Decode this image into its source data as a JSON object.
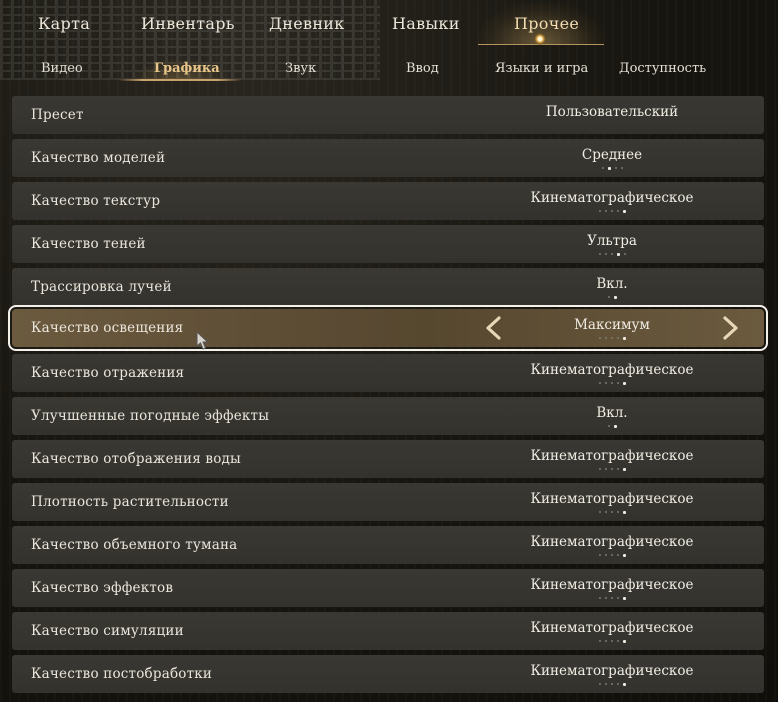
{
  "topnav": {
    "tabs": [
      {
        "label": "Карта"
      },
      {
        "label": "Инвентарь"
      },
      {
        "label": "Дневник"
      },
      {
        "label": "Навыки"
      },
      {
        "label": "Прочее"
      }
    ],
    "active": "Прочее"
  },
  "subnav": {
    "tabs": [
      {
        "label": "Видео"
      },
      {
        "label": "Графика"
      },
      {
        "label": "Звук"
      },
      {
        "label": "Ввод"
      },
      {
        "label": "Языки и игра"
      },
      {
        "label": "Доступность"
      }
    ],
    "active": "Графика"
  },
  "settings": [
    {
      "label": "Пресет",
      "value": "Пользовательский",
      "options_count": 0,
      "selected_option": 0
    },
    {
      "label": "Качество моделей",
      "value": "Среднее",
      "options_count": 4,
      "selected_option": 2
    },
    {
      "label": "Качество текстур",
      "value": "Кинематографическое",
      "options_count": 5,
      "selected_option": 5
    },
    {
      "label": "Качество теней",
      "value": "Ультра",
      "options_count": 5,
      "selected_option": 4
    },
    {
      "label": "Трассировка лучей",
      "value": "Вкл.",
      "options_count": 2,
      "selected_option": 2
    },
    {
      "label": "Качество освещения",
      "value": "Максимум",
      "options_count": 5,
      "selected_option": 5
    },
    {
      "label": "Качество отражения",
      "value": "Кинематографическое",
      "options_count": 5,
      "selected_option": 5
    },
    {
      "label": "Улучшенные погодные эффекты",
      "value": "Вкл.",
      "options_count": 2,
      "selected_option": 2
    },
    {
      "label": "Качество отображения воды",
      "value": "Кинематографическое",
      "options_count": 5,
      "selected_option": 5
    },
    {
      "label": "Плотность растительности",
      "value": "Кинематографическое",
      "options_count": 5,
      "selected_option": 5
    },
    {
      "label": "Качество объемного тумана",
      "value": "Кинематографическое",
      "options_count": 5,
      "selected_option": 5
    },
    {
      "label": "Качество эффектов",
      "value": "Кинематографическое",
      "options_count": 5,
      "selected_option": 5
    },
    {
      "label": "Качество симуляции",
      "value": "Кинематографическое",
      "options_count": 5,
      "selected_option": 5
    },
    {
      "label": "Качество постобработки",
      "value": "Кинематографическое",
      "options_count": 5,
      "selected_option": 5
    }
  ],
  "selected_index": 5,
  "icons": {
    "prev": "chevron-left-icon",
    "next": "chevron-right-icon",
    "cursor": "mouse-cursor-icon"
  },
  "colors": {
    "accent": "#e8c68a",
    "selected_row": "#6b5a3e",
    "row_bg": "#3a3833"
  }
}
